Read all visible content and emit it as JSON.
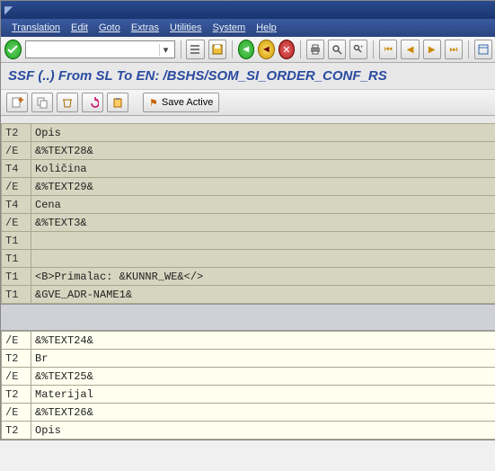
{
  "menu": {
    "translation": "Translation",
    "edit": "Edit",
    "goto": "Goto",
    "extras": "Extras",
    "utilities": "Utilities",
    "system": "System",
    "help": "Help"
  },
  "command_field": {
    "value": "",
    "placeholder": ""
  },
  "subtitle": "SSF (..) From SL To EN: /BSHS/SOM_SI_ORDER_CONF_RS",
  "app_toolbar": {
    "save_active": "Save Active"
  },
  "icons": {
    "titlebar": "sap-corner-icon",
    "ok": "check-icon",
    "dropdown": "list-icon",
    "save": "save-icon",
    "back": "back-icon",
    "exit": "exit-icon",
    "cancel": "cancel-icon",
    "print": "print-icon",
    "find": "find-icon",
    "findnext": "find-next-icon",
    "t1": "first-icon",
    "t2": "prev-icon",
    "t3": "next-icon",
    "t4": "last-icon",
    "t5": "layout-icon",
    "a1": "create-icon",
    "a2": "copy-icon",
    "a3": "delete-icon",
    "a4": "undo-icon",
    "a5": "paste-icon",
    "flag": "flag-icon"
  },
  "rows_top": [
    {
      "k": "T2",
      "v": "Opis"
    },
    {
      "k": "/E",
      "v": "&%TEXT28&"
    },
    {
      "k": "T4",
      "v": "Količina"
    },
    {
      "k": "/E",
      "v": "&%TEXT29&"
    },
    {
      "k": "T4",
      "v": "Cena"
    },
    {
      "k": "/E",
      "v": "&%TEXT3&"
    },
    {
      "k": "T1",
      "v": ""
    },
    {
      "k": "T1",
      "v": ""
    },
    {
      "k": "T1",
      "v": "<B>Primalac: &KUNNR_WE&</>"
    },
    {
      "k": "T1",
      "v": "&GVE_ADR-NAME1&"
    }
  ],
  "rows_bot": [
    {
      "k": "/E",
      "v": "&%TEXT24&"
    },
    {
      "k": "T2",
      "v": "Br"
    },
    {
      "k": "/E",
      "v": "&%TEXT25&"
    },
    {
      "k": "T2",
      "v": "Materijal"
    },
    {
      "k": "/E",
      "v": "&%TEXT26&"
    },
    {
      "k": "T2",
      "v": "Opis"
    }
  ]
}
